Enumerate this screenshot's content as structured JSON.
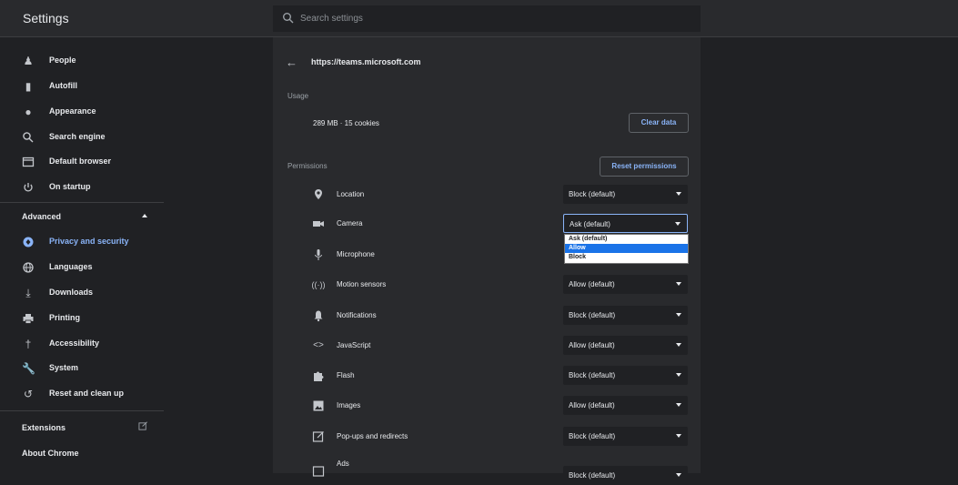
{
  "header": {
    "title": "Settings",
    "search_placeholder": "Search settings"
  },
  "sidebar": {
    "items": [
      {
        "label": "People",
        "icon": "person-icon"
      },
      {
        "label": "Autofill",
        "icon": "clipboard-icon"
      },
      {
        "label": "Appearance",
        "icon": "palette-icon"
      },
      {
        "label": "Search engine",
        "icon": "search-icon"
      },
      {
        "label": "Default browser",
        "icon": "browser-icon"
      },
      {
        "label": "On startup",
        "icon": "power-icon"
      }
    ],
    "advanced_label": "Advanced",
    "advanced_items": [
      {
        "label": "Privacy and security",
        "icon": "shield-icon",
        "active": true
      },
      {
        "label": "Languages",
        "icon": "globe-icon"
      },
      {
        "label": "Downloads",
        "icon": "download-icon"
      },
      {
        "label": "Printing",
        "icon": "printer-icon"
      },
      {
        "label": "Accessibility",
        "icon": "accessibility-icon"
      },
      {
        "label": "System",
        "icon": "wrench-icon"
      },
      {
        "label": "Reset and clean up",
        "icon": "reset-icon"
      }
    ],
    "extensions_label": "Extensions",
    "about_label": "About Chrome"
  },
  "main": {
    "site_url": "https://teams.microsoft.com",
    "usage_heading": "Usage",
    "usage_text": "289 MB · 15 cookies",
    "clear_data_label": "Clear data",
    "permissions_heading": "Permissions",
    "reset_permissions_label": "Reset permissions",
    "permissions": [
      {
        "label": "Location",
        "value": "Block (default)",
        "icon": "location-pin-icon"
      },
      {
        "label": "Camera",
        "value": "Ask (default)",
        "icon": "camera-icon"
      },
      {
        "label": "Microphone",
        "value": "",
        "icon": "microphone-icon"
      },
      {
        "label": "Motion sensors",
        "value": "Allow (default)",
        "icon": "motion-sensor-icon"
      },
      {
        "label": "Notifications",
        "value": "Block (default)",
        "icon": "bell-icon"
      },
      {
        "label": "JavaScript",
        "value": "Allow (default)",
        "icon": "code-icon"
      },
      {
        "label": "Flash",
        "value": "Block (default)",
        "icon": "puzzle-icon"
      },
      {
        "label": "Images",
        "value": "Allow (default)",
        "icon": "image-icon"
      },
      {
        "label": "Pop-ups and redirects",
        "value": "Block (default)",
        "icon": "popup-icon"
      },
      {
        "label": "Ads",
        "value": "Block (default)",
        "icon": "ads-icon"
      }
    ],
    "camera_dropdown_options": [
      "Ask (default)",
      "Allow",
      "Block"
    ],
    "camera_dropdown_highlighted": "Allow"
  },
  "colors": {
    "accent": "#8ab4f8",
    "highlight": "#1a73e8",
    "background": "#202124",
    "panel": "#292a2d"
  }
}
